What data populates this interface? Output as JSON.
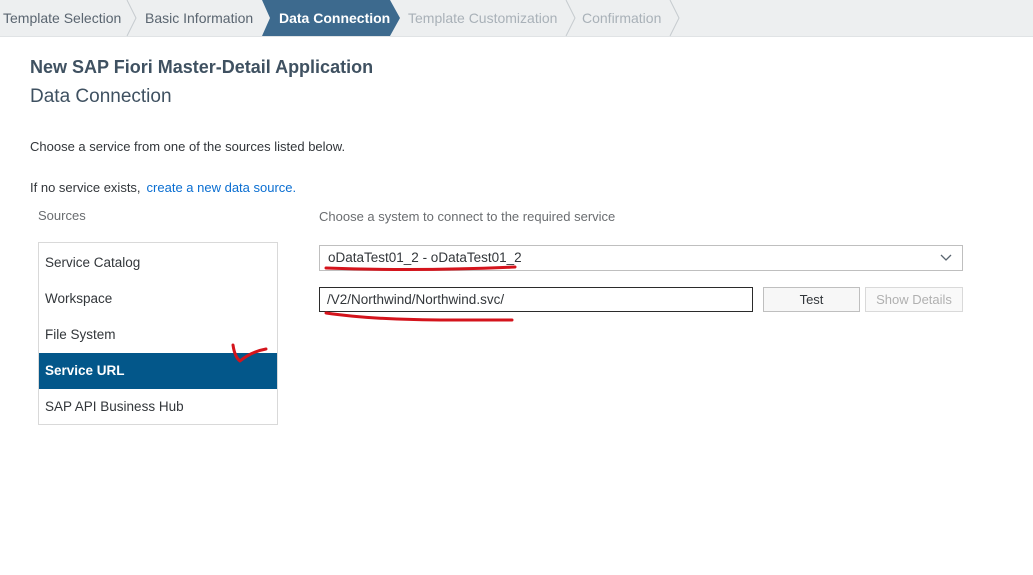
{
  "wizard": {
    "steps": [
      {
        "label": "Template Selection",
        "state": "done"
      },
      {
        "label": "Basic Information",
        "state": "done"
      },
      {
        "label": "Data Connection",
        "state": "active"
      },
      {
        "label": "Template Customization",
        "state": "todo"
      },
      {
        "label": "Confirmation",
        "state": "todo"
      }
    ]
  },
  "header": {
    "app_title": "New SAP Fiori Master-Detail Application",
    "page_title": "Data Connection"
  },
  "main": {
    "instruction": "Choose a service from one of the sources listed below.",
    "no_service_text": "If no service exists,",
    "create_link": "create a new data source."
  },
  "sources": {
    "label": "Sources",
    "items": [
      {
        "label": "Service Catalog",
        "selected": false
      },
      {
        "label": "Workspace",
        "selected": false
      },
      {
        "label": "File System",
        "selected": false
      },
      {
        "label": "Service URL",
        "selected": true
      },
      {
        "label": "SAP API Business Hub",
        "selected": false
      }
    ]
  },
  "connection": {
    "system_label": "Choose a system to connect to the required service",
    "system_value": "oDataTest01_2 - oDataTest01_2",
    "url_value": "/V2/Northwind/Northwind.svc/",
    "test_button": "Test",
    "details_button": "Show Details"
  },
  "icons": {
    "select_chevron": "chevron-down-icon",
    "annotation_checkmark": "checkmark-icon"
  },
  "colors": {
    "stepbar_bg": "#edeff0",
    "active_step": "#3d6a8e",
    "selected_item": "#03578a",
    "link": "#0a6ed1",
    "annotation": "#d4141c"
  }
}
